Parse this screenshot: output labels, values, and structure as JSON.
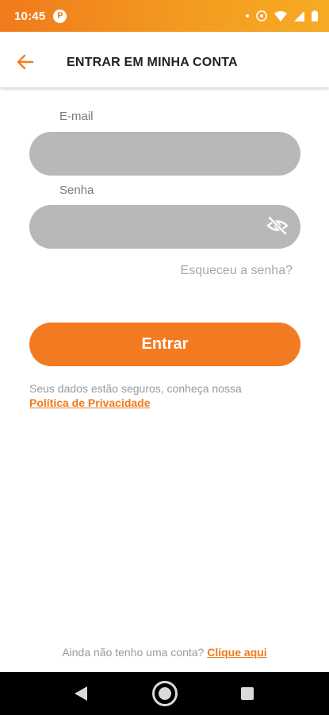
{
  "status_bar": {
    "time": "10:45",
    "app_icon_letter": "P",
    "icons": [
      "notification-dot",
      "hotspot-icon",
      "wifi-icon",
      "signal-icon",
      "battery-icon"
    ]
  },
  "app_bar": {
    "title": "ENTRAR EM MINHA CONTA",
    "back_icon": "arrow-left-icon"
  },
  "form": {
    "email_label": "E-mail",
    "email_value": "",
    "password_label": "Senha",
    "password_value": "",
    "password_toggle_icon": "eye-off-icon",
    "forgot_password": "Esqueceu a senha?",
    "submit_label": "Entrar"
  },
  "privacy": {
    "text": "Seus dados estão seguros, conheça nossa",
    "link": "Política de Privacidade"
  },
  "signup": {
    "text": "Ainda não tenho uma conta?",
    "link": "Clique aqui"
  },
  "colors": {
    "accent": "#f27b21",
    "input_background": "#b8b8b8",
    "muted_text": "#9a9a9a"
  }
}
